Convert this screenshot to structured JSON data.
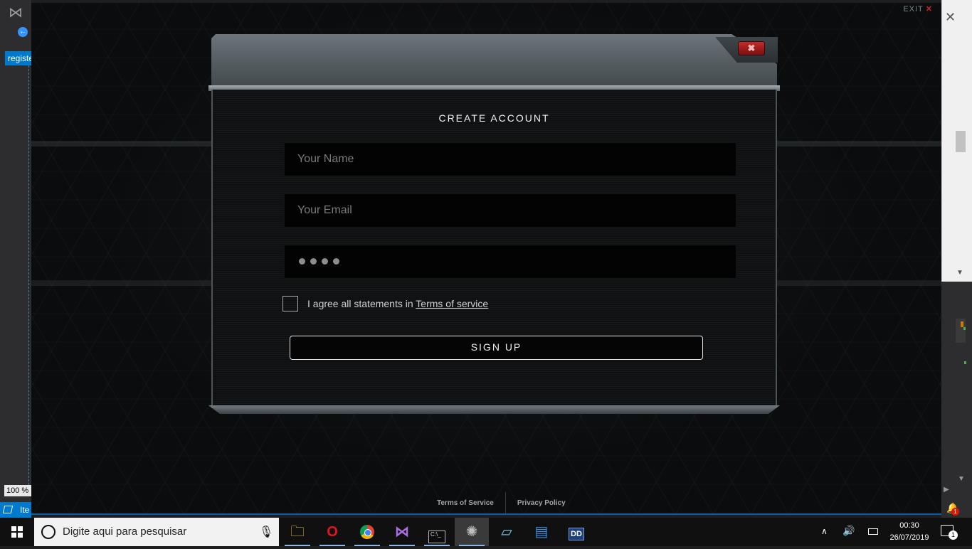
{
  "ide": {
    "tab_label": "registe",
    "zoom": "100 %",
    "status_text": "Ite",
    "notifications_badge": "1"
  },
  "app": {
    "exit_label": "EXIT",
    "exit_icon": "close-x-icon"
  },
  "dialog": {
    "title": "CREATE ACCOUNT",
    "close_icon": "close-icon",
    "name_placeholder": "Your Name",
    "email_placeholder": "Your Email",
    "password_value": "••••",
    "agree_text": "I agree all statements in",
    "agree_link": "Terms of service",
    "signup_label": "SIGN UP"
  },
  "footer": {
    "links": [
      "Terms of Service",
      "Privacy Policy"
    ]
  },
  "taskbar": {
    "search_placeholder": "Digite aqui para pesquisar",
    "apps": [
      "file-explorer-icon",
      "opera-icon",
      "chrome-icon",
      "visual-studio-icon",
      "cmd-icon",
      "gear-app-icon",
      "notepad-icon",
      "store-icon",
      "dolby-icon"
    ],
    "time": "00:30",
    "date": "26/07/2019",
    "action_center_badge": "1"
  }
}
